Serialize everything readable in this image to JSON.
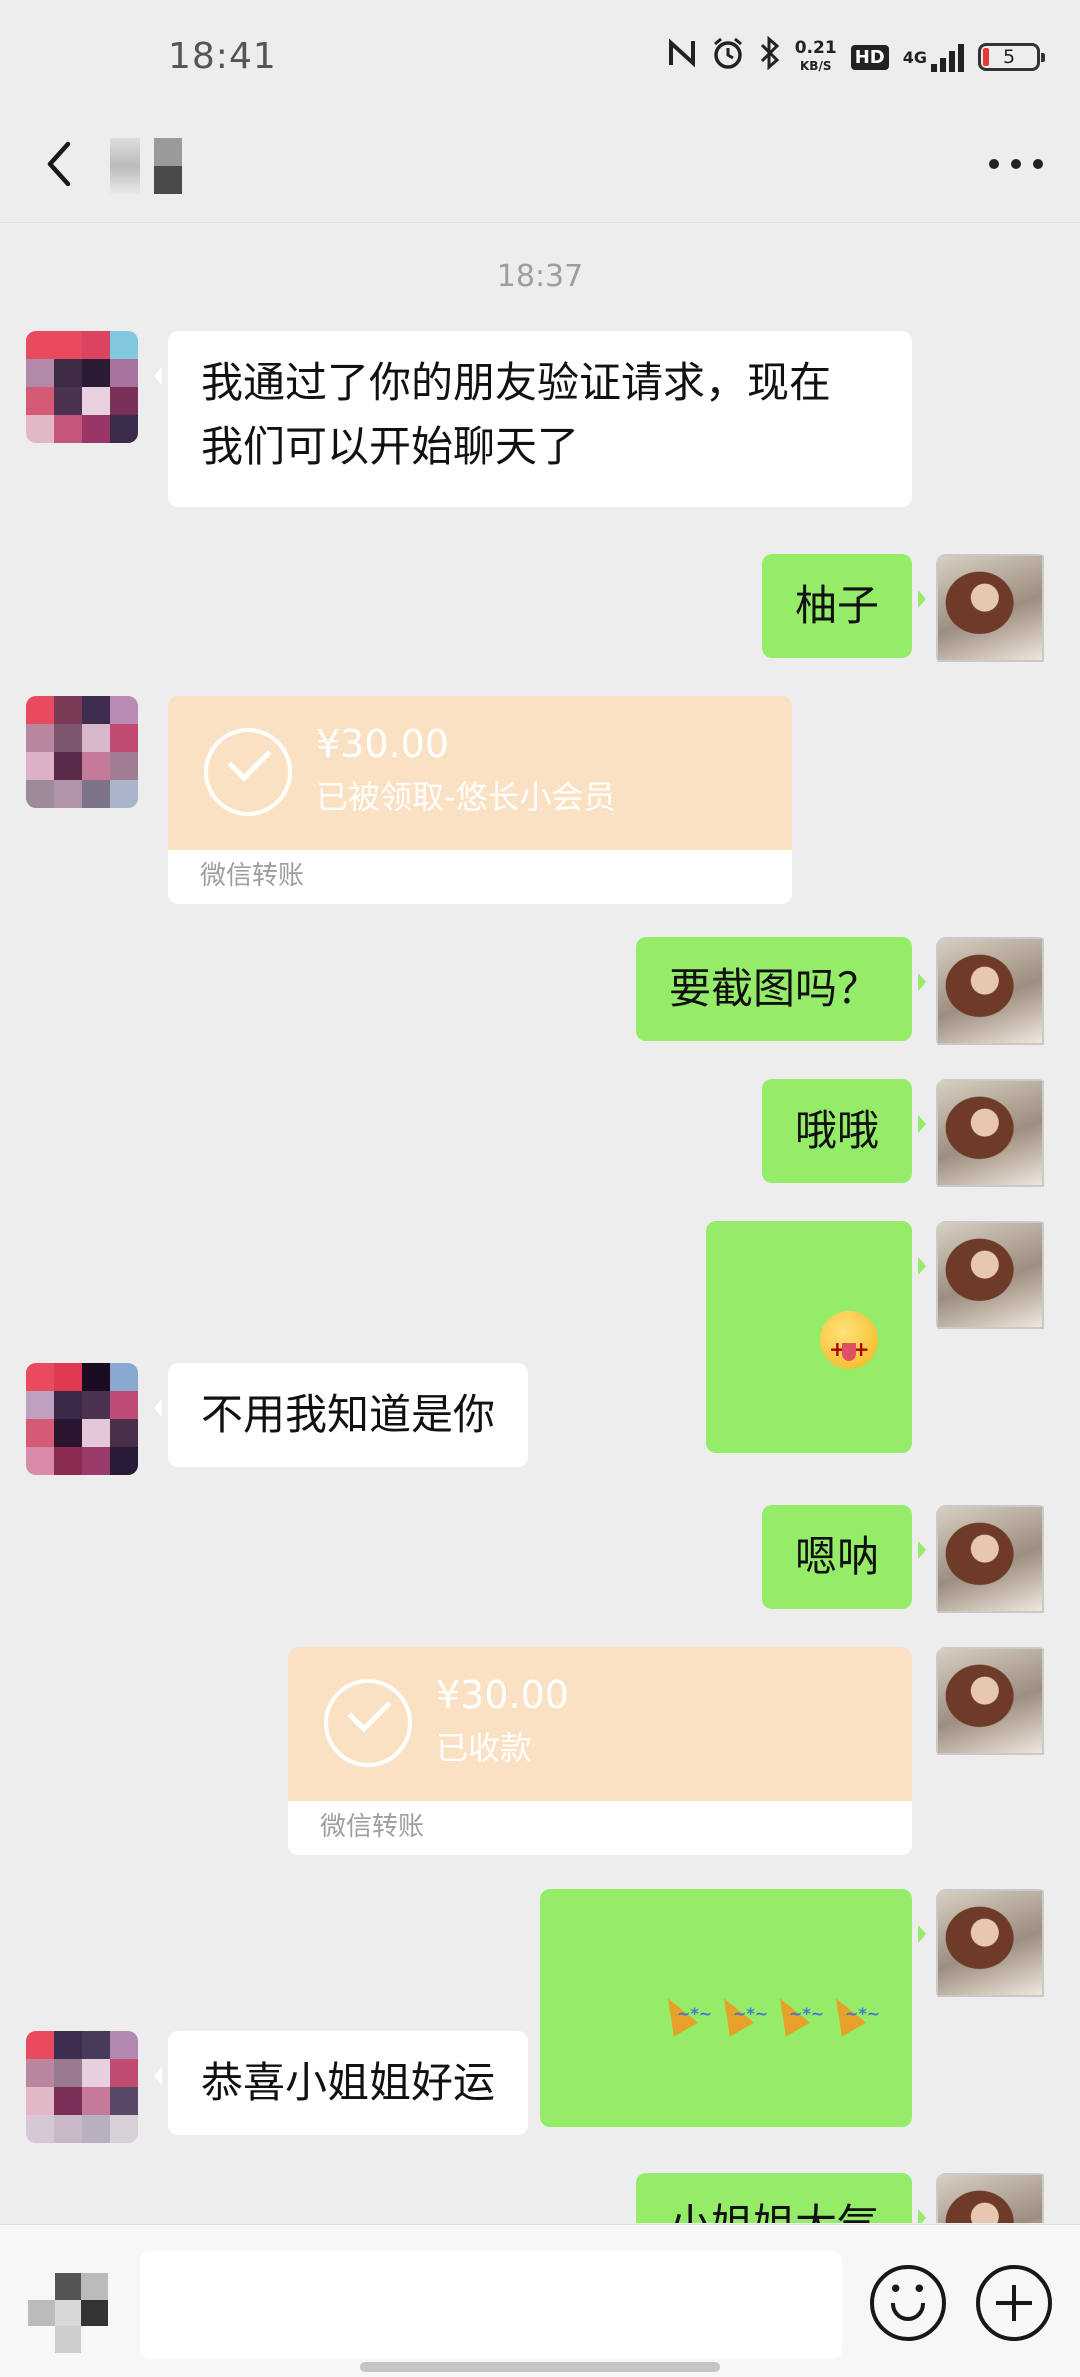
{
  "status_bar": {
    "time": "18:41",
    "net_speed_value": "0.21",
    "net_speed_unit": "KB/S",
    "hd_label": "HD",
    "network_label": "4G",
    "battery_level": "5"
  },
  "header": {
    "contact_name": "",
    "icons": {
      "back": "chevron-left-icon",
      "more": "more-dots-icon"
    }
  },
  "chat": {
    "timestamp": "18:37",
    "messages": [
      {
        "side": "left",
        "type": "text",
        "text": "我通过了你的朋友验证请求，现在\n我们可以开始聊天了"
      },
      {
        "side": "right",
        "type": "text",
        "text": "柚子"
      },
      {
        "side": "left",
        "type": "transfer",
        "amount": "¥30.00",
        "status": "已被领取-悠长小会员",
        "footer": "微信转账"
      },
      {
        "side": "right",
        "type": "text",
        "text": "要截图吗？"
      },
      {
        "side": "right",
        "type": "text",
        "text": "哦哦"
      },
      {
        "side": "right",
        "type": "emoji",
        "emoji": "dizzy-tongue-face"
      },
      {
        "side": "left",
        "type": "text",
        "text": "不用我知道是你"
      },
      {
        "side": "right",
        "type": "text",
        "text": "嗯呐"
      },
      {
        "side": "right",
        "type": "transfer",
        "amount": "¥30.00",
        "status": "已收款",
        "footer": "微信转账"
      },
      {
        "side": "right",
        "type": "emoji",
        "emoji": "party-popper x4"
      },
      {
        "side": "left",
        "type": "text",
        "text": "恭喜小姐姐好运"
      },
      {
        "side": "right",
        "type": "text",
        "text": "小姐姐大气"
      }
    ]
  },
  "input_bar": {
    "input_value": "",
    "icons": {
      "voice": "voice-input-icon",
      "sticker": "smiley-face-icon",
      "more": "plus-circle-icon"
    }
  },
  "colors": {
    "background": "#ededed",
    "sent_bubble": "#95ec69",
    "received_bubble": "#ffffff",
    "transfer_card": "#fbe1c3"
  }
}
